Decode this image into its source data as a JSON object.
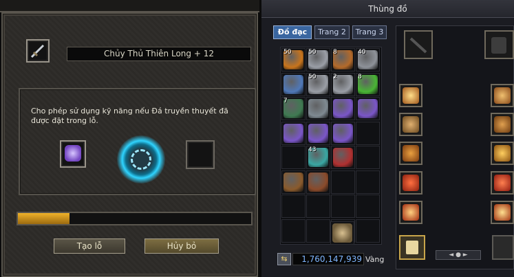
{
  "left_panel": {
    "item_name": "Chủy Thủ Thiên Long + 12",
    "description": "Cho phép sử dụng kỹ năng nếu Đá truyền thuyết đã được đặt trong lỗ.",
    "progress": 0.22,
    "create_socket_label": "Tạo lỗ",
    "cancel_label": "Hủy bỏ"
  },
  "inventory": {
    "title": "Thùng đồ",
    "tabs": [
      {
        "label": "Đồ đạc",
        "active": true
      },
      {
        "label": "Trang 2",
        "active": false
      },
      {
        "label": "Trang 3",
        "active": false
      }
    ],
    "money": "1,760,147,939",
    "currency_label": "Vàng",
    "items": [
      {
        "row": 0,
        "col": 0,
        "icon": "orange-coin-icon",
        "qty": "50",
        "color": "#c8741c"
      },
      {
        "row": 0,
        "col": 1,
        "icon": "silver-coin-icon",
        "qty": "50",
        "color": "#9a9ea6"
      },
      {
        "row": 0,
        "col": 2,
        "icon": "bronze-coin-icon",
        "qty": "8",
        "color": "#b46a2a"
      },
      {
        "row": 0,
        "col": 3,
        "icon": "silver-coin-icon",
        "qty": "40",
        "color": "#8e9299"
      },
      {
        "row": 1,
        "col": 0,
        "icon": "blue-pet-icon",
        "qty": "",
        "color": "#4f78b8"
      },
      {
        "row": 1,
        "col": 1,
        "icon": "silver-coin-icon",
        "qty": "50",
        "color": "#9a9ea6"
      },
      {
        "row": 1,
        "col": 2,
        "icon": "silver-coin-icon",
        "qty": "2",
        "color": "#9a9ea6"
      },
      {
        "row": 1,
        "col": 3,
        "icon": "green-potion-icon",
        "qty": "8",
        "color": "#49b535"
      },
      {
        "row": 2,
        "col": 0,
        "icon": "green-scroll-icon",
        "qty": "7",
        "color": "#3f7a52"
      },
      {
        "row": 2,
        "col": 1,
        "icon": "dagger-icon",
        "qty": "",
        "color": "#7f8a92"
      },
      {
        "row": 2,
        "col": 2,
        "icon": "purple-rune-icon",
        "qty": "",
        "color": "#7a56c8"
      },
      {
        "row": 2,
        "col": 3,
        "icon": "purple-rune-icon",
        "qty": "",
        "color": "#7a56c8"
      },
      {
        "row": 3,
        "col": 0,
        "icon": "purple-rune-icon",
        "qty": "",
        "color": "#7a56c8"
      },
      {
        "row": 3,
        "col": 1,
        "icon": "purple-rune-icon",
        "qty": "",
        "color": "#7a56c8"
      },
      {
        "row": 3,
        "col": 2,
        "icon": "purple-rune-icon",
        "qty": "",
        "color": "#7a56c8"
      },
      {
        "row": 4,
        "col": 1,
        "icon": "teal-scroll-icon",
        "qty": "43",
        "color": "#3aa7a3"
      },
      {
        "row": 4,
        "col": 2,
        "icon": "red-cape-icon",
        "qty": "",
        "color": "#b03030"
      },
      {
        "row": 5,
        "col": 0,
        "icon": "armor-icon",
        "qty": "",
        "color": "#8a5a2c"
      },
      {
        "row": 5,
        "col": 1,
        "icon": "armor-icon",
        "qty": "",
        "color": "#8a4a2a"
      },
      {
        "row": 8,
        "col": 2,
        "icon": "bow-icon",
        "qty": "",
        "color": "#6c5a3a"
      }
    ]
  }
}
